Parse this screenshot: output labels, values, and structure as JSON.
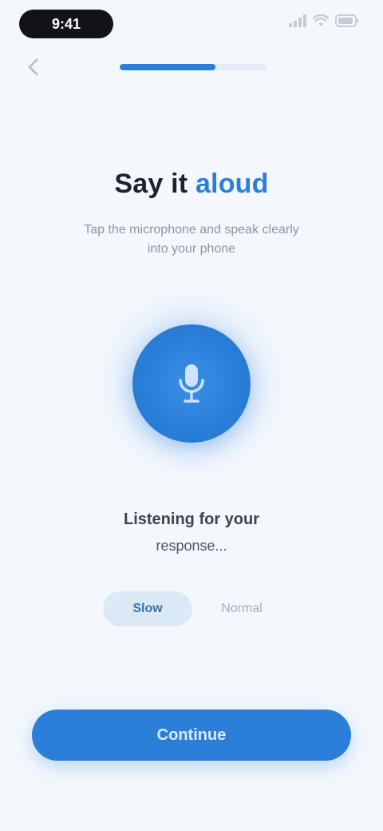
{
  "status_bar": {
    "time": "9:41",
    "icons": [
      "signal-icon",
      "wifi-icon",
      "battery-icon"
    ]
  },
  "nav": {
    "back_icon": "chevron-left-icon",
    "progress": 0.65
  },
  "heading": {
    "part1": "Say it",
    "part2": "aloud"
  },
  "subtitle": "Tap the microphone and speak clearly into your phone",
  "mic": {
    "icon": "microphone-icon"
  },
  "status": {
    "line1": "Listening for your",
    "line2": "response..."
  },
  "chips": [
    {
      "label": "Slow"
    },
    {
      "label": "Normal"
    }
  ],
  "primary_button": {
    "label": "Continue"
  },
  "colors": {
    "accent": "#2b7fd9",
    "background": "#f4f8fd",
    "heading": "#1b2330",
    "muted": "#8b96a6"
  }
}
